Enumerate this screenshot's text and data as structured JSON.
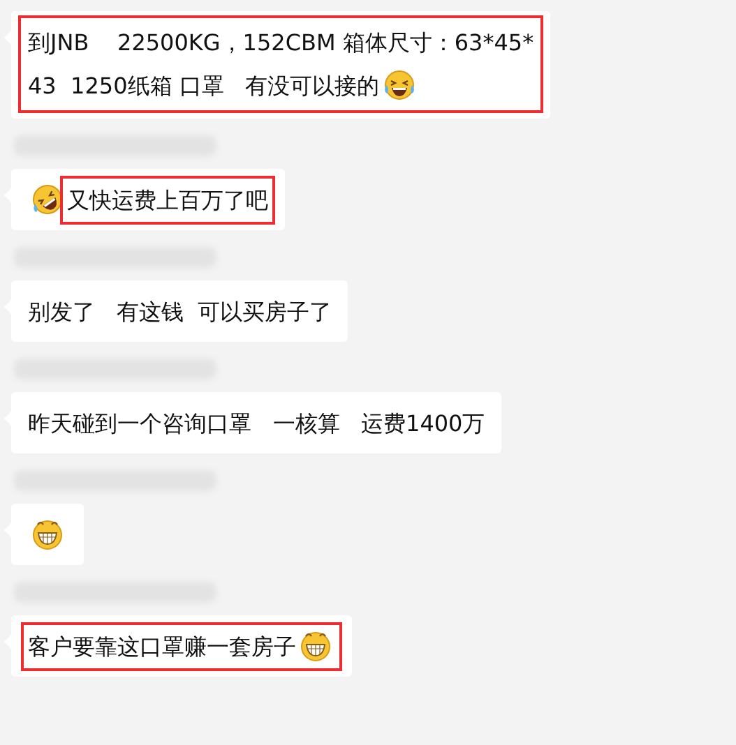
{
  "messages": [
    {
      "sender_blurred": false,
      "segments": [
        {
          "kind": "line",
          "text": "到JNB    22500KG，152CBM 箱体尺寸：63*45*",
          "highlighted": true
        },
        {
          "kind": "text",
          "text": "43  1250纸箱 口罩   有没可以接的",
          "highlighted": true
        },
        {
          "kind": "laugh-tears",
          "highlighted": true
        }
      ]
    },
    {
      "sender_blurred": true,
      "segments": [
        {
          "kind": "rolling-laugh",
          "highlighted": false
        },
        {
          "kind": "text",
          "text": "又快运费上百万了吧",
          "highlighted": true
        }
      ]
    },
    {
      "sender_blurred": true,
      "segments": [
        {
          "kind": "text",
          "text": "别发了   有这钱  可以买房子了",
          "highlighted": false
        }
      ]
    },
    {
      "sender_blurred": true,
      "segments": [
        {
          "kind": "text",
          "text": "昨天碰到一个咨询口罩   一核算   运费1400万",
          "highlighted": false
        }
      ]
    },
    {
      "sender_blurred": true,
      "segments": [
        {
          "kind": "grin",
          "highlighted": false
        }
      ]
    },
    {
      "sender_blurred": true,
      "segments": [
        {
          "kind": "text",
          "text": "客户要靠这口罩赚一套房子",
          "highlighted": true
        },
        {
          "kind": "grin",
          "highlighted": true
        }
      ]
    }
  ]
}
